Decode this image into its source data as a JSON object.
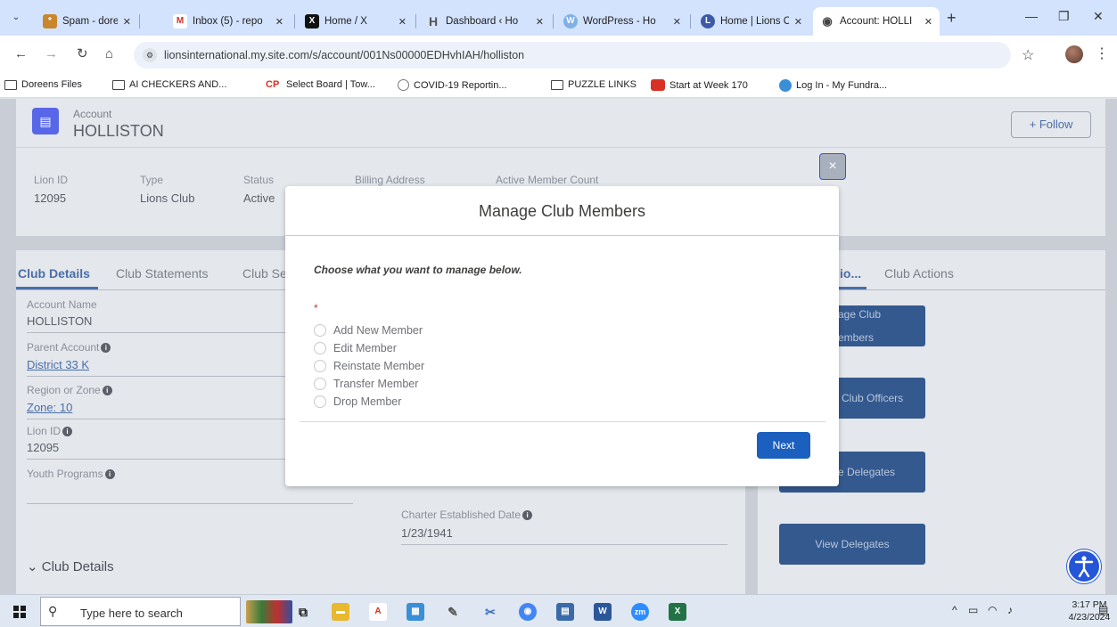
{
  "browser": {
    "tabs": [
      {
        "title": "Spam - doreenn",
        "fav_color": "#c9862b",
        "fav_glyph": "*"
      },
      {
        "title": "Inbox (5) - repo",
        "fav_color": "#d93025",
        "fav_glyph": "M"
      },
      {
        "title": "Home / X",
        "fav_color": "#111111",
        "fav_glyph": "X"
      },
      {
        "title": "Dashboard ‹ Ho",
        "fav_color": "#777777",
        "fav_glyph": "H"
      },
      {
        "title": "WordPress - Ho",
        "fav_color": "#7fb0e8",
        "fav_glyph": "W"
      },
      {
        "title": "Home | Lions Cl",
        "fav_color": "#3d5aa9",
        "fav_glyph": "L"
      },
      {
        "title": "Account: HOLLI",
        "fav_color": "#555555",
        "fav_glyph": "◉"
      }
    ],
    "new_tab_glyph": "+",
    "url": "lionsinternational.my.site.com/s/account/001Ns00000EDHvhIAH/holliston",
    "bookmarks": [
      {
        "label": "Doreens Files",
        "icon": "folder-icon"
      },
      {
        "label": "AI CHECKERS AND...",
        "icon": "folder-icon"
      },
      {
        "label": "Select Board | Tow...",
        "icon": "cp-icon"
      },
      {
        "label": "COVID-19 Reportin...",
        "icon": "covid-icon"
      },
      {
        "label": "PUZZLE LINKS",
        "icon": "folder-icon"
      },
      {
        "label": "Start at Week 170",
        "icon": "week-icon"
      },
      {
        "label": "Log In - My Fundra...",
        "icon": "fundra-icon"
      }
    ]
  },
  "account": {
    "type_label": "Account",
    "name": "HOLLISTON",
    "follow_label": "Follow",
    "highlights": [
      {
        "label": "Lion ID",
        "value": "12095"
      },
      {
        "label": "Type",
        "value": "Lions Club"
      },
      {
        "label": "Status",
        "value": "Active"
      },
      {
        "label": "Billing Address",
        "value": ""
      },
      {
        "label": "Active Member Count",
        "value": ""
      }
    ]
  },
  "tabs": {
    "items": [
      "Club Details",
      "Club Statements",
      "Club Se"
    ],
    "right_items": [
      "io...",
      "Club Actions"
    ]
  },
  "details": {
    "account_name_label": "Account Name",
    "account_name": "HOLLISTON",
    "parent_account_label": "Parent Account",
    "parent_account": "District 33 K",
    "region_label": "Region or Zone",
    "region": "Zone: 10",
    "lion_id_label": "Lion ID",
    "lion_id": "12095",
    "youth_label": "Youth Programs",
    "charter_label": "Charter Established Date",
    "charter_date": "1/23/1941",
    "section_header": "Club Details"
  },
  "actions": {
    "manage_1": "age Club",
    "manage_2": "embers",
    "officers": "Club Officers",
    "delegates_partial": "e Delegates",
    "view_delegates": "View Delegates"
  },
  "modal": {
    "title": "Manage Club Members",
    "instruction": "Choose what you want to manage below.",
    "required_mark": "*",
    "options": [
      "Add New Member",
      "Edit Member",
      "Reinstate Member",
      "Transfer Member",
      "Drop Member"
    ],
    "next_label": "Next",
    "close_glyph": "×"
  },
  "taskbar": {
    "search_placeholder": "Type here to search",
    "time": "3:17 PM",
    "date": "4/23/2024"
  }
}
